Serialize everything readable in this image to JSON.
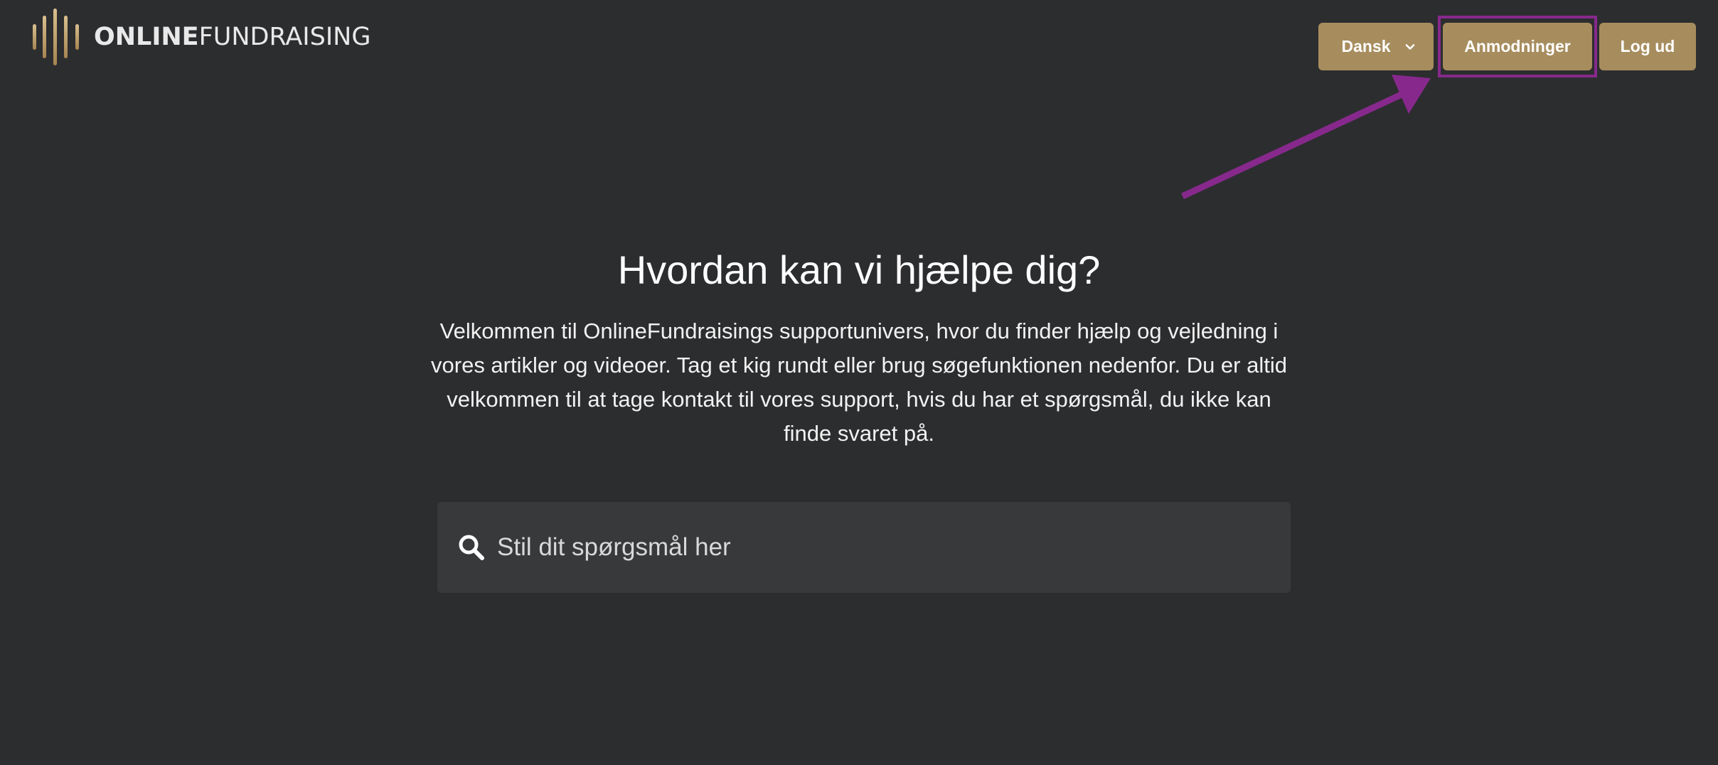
{
  "brand": {
    "name_bold": "ONLINE",
    "name_light": "FUNDRAISING"
  },
  "nav": {
    "language_label": "Dansk",
    "requests_label": "Anmodninger",
    "logout_label": "Log ud"
  },
  "hero": {
    "title": "Hvordan kan vi hjælpe dig?",
    "description": "Velkommen til OnlineFundraisings supportunivers, hvor du finder hjælp og vejledning i vores artikler og videoer. Tag et kig rundt eller brug søgefunktionen nedenfor. Du er altid velkommen til at tage kontakt til vores support, hvis du har et spørgsmål, du ikke kan finde svaret på."
  },
  "search": {
    "placeholder": "Stil dit spørgsmål her",
    "value": ""
  },
  "icons": {
    "logo": "vertical-bars-logo-icon",
    "language_dropdown": "chevron-down-icon",
    "search": "search-icon",
    "annotation": "arrow-annotation-icon"
  },
  "colors": {
    "background": "#2c2d2f",
    "accent": "#a78d5e",
    "annotation": "#87298c",
    "search_background": "#38393b"
  }
}
